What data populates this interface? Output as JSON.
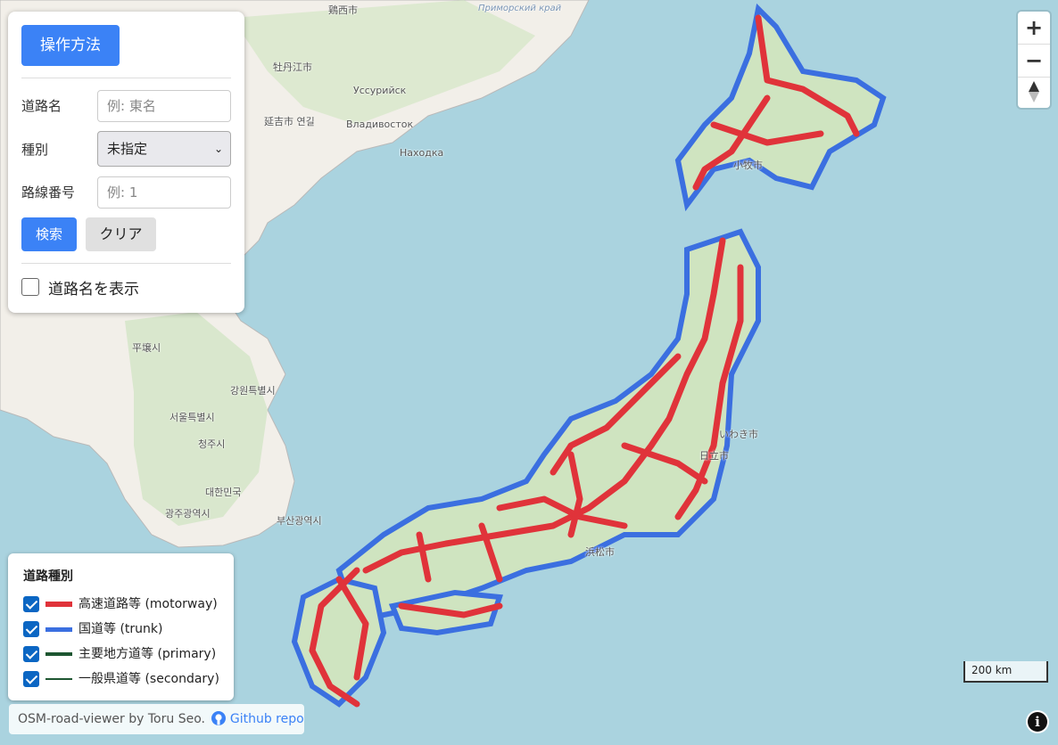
{
  "search_panel": {
    "help_button": "操作方法",
    "road_name_label": "道路名",
    "road_name_placeholder": "例: 東名",
    "type_label": "種別",
    "type_value": "未指定",
    "route_number_label": "路線番号",
    "route_number_placeholder": "例: 1",
    "search_button": "検索",
    "clear_button": "クリア",
    "show_names_label": "道路名を表示",
    "show_names_checked": false
  },
  "legend": {
    "title": "道路種別",
    "items": [
      {
        "label": "高速道路等 (motorway)",
        "color": "#e0333a",
        "checked": true
      },
      {
        "label": "国道等 (trunk)",
        "color": "#3b6fe0",
        "checked": true
      },
      {
        "label": "主要地方道等 (primary)",
        "color": "#1e5631",
        "checked": true
      },
      {
        "label": "一般県道等 (secondary)",
        "color": "#1e5631",
        "checked": true
      }
    ]
  },
  "zoom": {
    "in": "+",
    "out": "−",
    "compass": "compass-icon"
  },
  "scale_bar": "200 km",
  "attribution": {
    "text": "OSM-road-viewer by Toru Seo.",
    "link": "Github repo"
  },
  "map_labels": [
    "鶏西市",
    "Приморский край",
    "牡丹江市",
    "延吉市 연길",
    "Владивосток",
    "Уссурийск",
    "Находка",
    "平壌시",
    "서울특별시",
    "대한민국",
    "광주광역시",
    "부산광역시",
    "청주시",
    "강원특별시",
    "浜松市",
    "小牧市",
    "日立市",
    "いわき市"
  ]
}
